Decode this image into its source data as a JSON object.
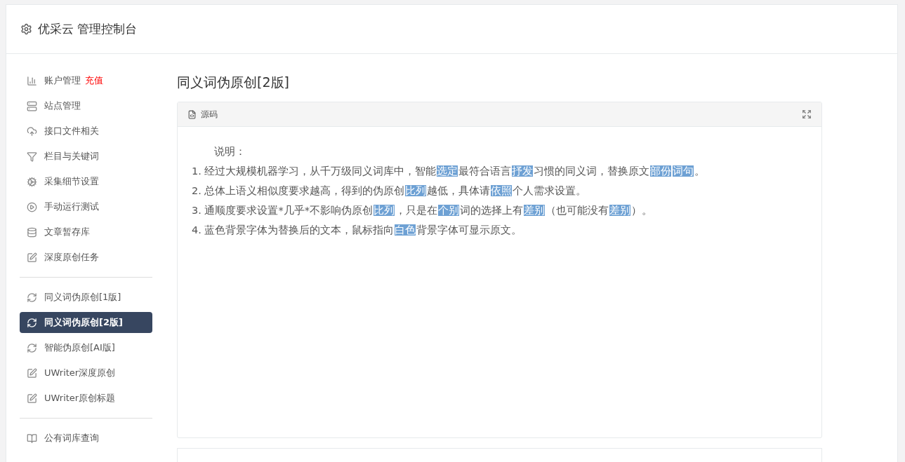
{
  "header": {
    "title": "优采云 管理控制台"
  },
  "sidebar": {
    "groups": [
      {
        "items": [
          {
            "label": "账户管理",
            "badge": "充值",
            "selected": false
          },
          {
            "label": "站点管理",
            "selected": false
          },
          {
            "label": "接口文件相关",
            "selected": false
          },
          {
            "label": "栏目与关键词",
            "selected": false
          },
          {
            "label": "采集细节设置",
            "selected": false
          },
          {
            "label": "手动运行测试",
            "selected": false
          },
          {
            "label": "文章暂存库",
            "selected": false
          },
          {
            "label": "深度原创任务",
            "selected": false
          }
        ]
      },
      {
        "items": [
          {
            "label": "同义词伪原创[1版]",
            "selected": false
          },
          {
            "label": "同义词伪原创[2版]",
            "selected": true
          },
          {
            "label": "智能伪原创[AI版]",
            "selected": false
          },
          {
            "label": "UWriter深度原创",
            "selected": false
          },
          {
            "label": "UWriter原创标题",
            "selected": false
          }
        ]
      },
      {
        "items": [
          {
            "label": "公有词库查询",
            "selected": false
          }
        ]
      }
    ]
  },
  "main": {
    "title": "同义词伪原创[2版]",
    "panel": {
      "title": "源码",
      "heading": "说明：",
      "lines": [
        [
          {
            "text": "1. 经过大规模机器学习，从千万级同义词库中，智能",
            "highlighted": false
          },
          {
            "text": "选定",
            "highlighted": true
          },
          {
            "text": "最符合语言",
            "highlighted": false
          },
          {
            "text": "抒发",
            "highlighted": true
          },
          {
            "text": "习惯的同义词，替换原文",
            "highlighted": false
          },
          {
            "text": "部份",
            "highlighted": true
          },
          {
            "text": "词句",
            "highlighted": true
          },
          {
            "text": "。",
            "highlighted": false
          }
        ],
        [
          {
            "text": "2. 总体上语义相似度要求越高，得到的伪原创",
            "highlighted": false
          },
          {
            "text": "比列",
            "highlighted": true
          },
          {
            "text": "越低，具体请",
            "highlighted": false
          },
          {
            "text": "依照",
            "highlighted": true
          },
          {
            "text": "个人需求设置。",
            "highlighted": false
          }
        ],
        [
          {
            "text": "3. 通顺度要求设置*几乎*不影响伪原创",
            "highlighted": false
          },
          {
            "text": "比列",
            "highlighted": true
          },
          {
            "text": "，只是在",
            "highlighted": false
          },
          {
            "text": "个别",
            "highlighted": true
          },
          {
            "text": "词的选择上有",
            "highlighted": false
          },
          {
            "text": "差别",
            "highlighted": true
          },
          {
            "text": "（也可能没有",
            "highlighted": false
          },
          {
            "text": "差别",
            "highlighted": true
          },
          {
            "text": "）。",
            "highlighted": false
          }
        ],
        [
          {
            "text": "4. 蓝色背景字体为替换后的文本，鼠标指向",
            "highlighted": false
          },
          {
            "text": "白色",
            "highlighted": true
          },
          {
            "text": "背景字体可显示原文。",
            "highlighted": false
          }
        ]
      ]
    }
  }
}
